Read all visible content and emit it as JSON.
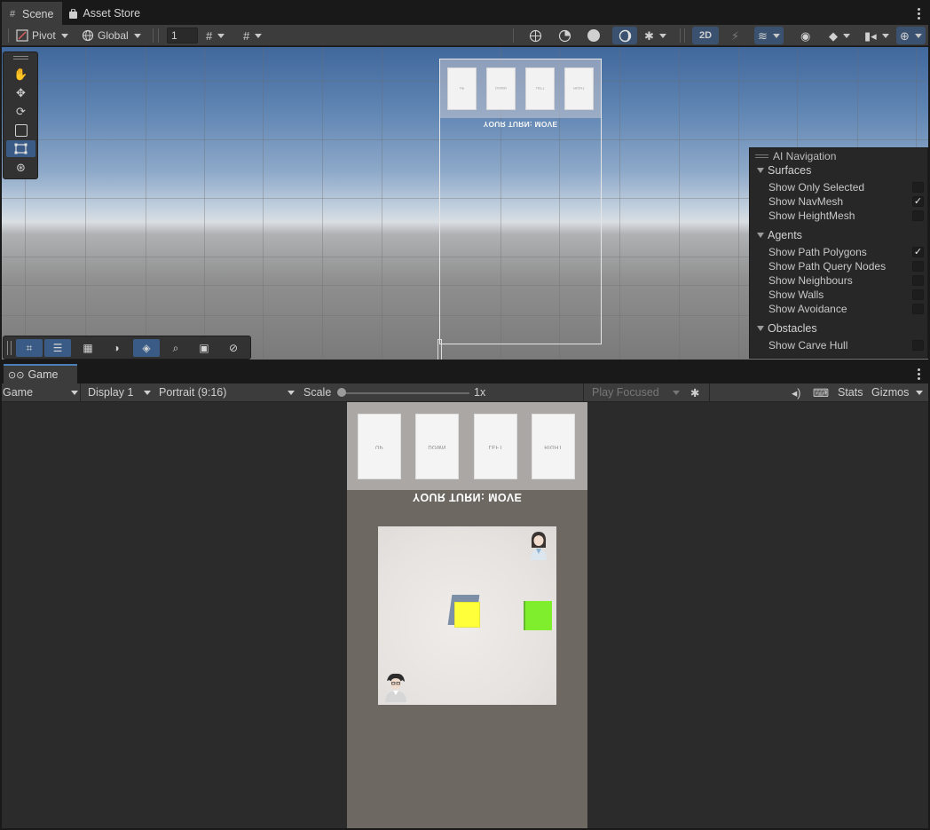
{
  "scene_tabs": [
    {
      "label": "Scene",
      "icon": "grid-icon",
      "active": true
    },
    {
      "label": "Asset Store",
      "icon": "bag-icon",
      "active": false
    }
  ],
  "scene_toolbar": {
    "pivot": "Pivot",
    "global": "Global",
    "grid_value": "1",
    "toggle_2d": "2D"
  },
  "scene_view": {
    "canvas_cards": [
      "UP",
      "DOWN",
      "LEFT",
      "RIGHT"
    ],
    "turn_text": "YOUR TURN: MOVE"
  },
  "ai_navigation": {
    "title": "AI Navigation",
    "sections": [
      {
        "name": "Surfaces",
        "options": [
          {
            "label": "Show Only Selected",
            "checked": false
          },
          {
            "label": "Show NavMesh",
            "checked": true
          },
          {
            "label": "Show HeightMesh",
            "checked": false
          }
        ]
      },
      {
        "name": "Agents",
        "options": [
          {
            "label": "Show Path Polygons",
            "checked": true
          },
          {
            "label": "Show Path Query Nodes",
            "checked": false
          },
          {
            "label": "Show Neighbours",
            "checked": false
          },
          {
            "label": "Show Walls",
            "checked": false
          },
          {
            "label": "Show Avoidance",
            "checked": false
          }
        ]
      },
      {
        "name": "Obstacles",
        "options": [
          {
            "label": "Show Carve Hull",
            "checked": false
          }
        ]
      }
    ]
  },
  "game_panel": {
    "tab_label": "Game",
    "view_select": "Game",
    "display": "Display 1",
    "aspect": "Portrait (9:16)",
    "scale_label": "Scale",
    "scale_value": "1x",
    "play_mode": "Play Focused",
    "stats": "Stats",
    "gizmos": "Gizmos"
  },
  "game_view": {
    "cards": [
      "UP",
      "DOWN",
      "LEFT",
      "RIGHT"
    ],
    "turn_text": "YOUR TURN: MOVE"
  },
  "colors": {
    "accent": "#3a5b85",
    "yellow_cube": "#ffff3a",
    "green_cube": "#7fee2c"
  }
}
